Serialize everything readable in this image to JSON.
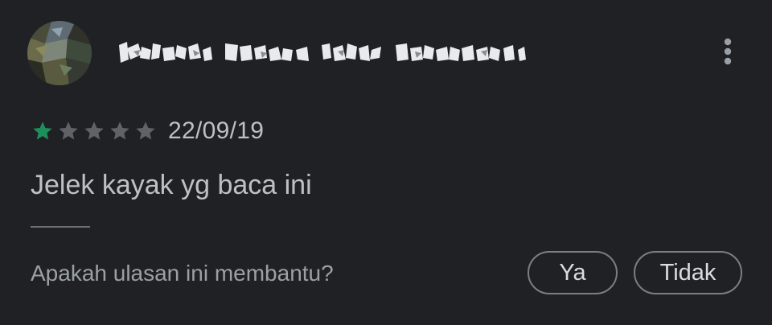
{
  "review": {
    "author": {
      "name": "Kristo Marta Nugroho Pratama",
      "name_obscured": true,
      "avatar_icon": "blurred-profile-photo"
    },
    "menu_icon": "more-vert-icon",
    "rating": {
      "value": 1,
      "max": 5,
      "filled_color": "#1e8e5c",
      "empty_color": "#5f6368"
    },
    "date": "22/09/19",
    "text": "Jelek kayak yg baca ini"
  },
  "helpful": {
    "question": "Apakah ulasan ini membantu?",
    "yes_label": "Ya",
    "no_label": "Tidak"
  },
  "colors": {
    "background": "#202124",
    "text": "#bdc1c6",
    "muted_text": "#9aa0a6",
    "chip_border": "#7b7f84",
    "accent_star": "#1e8e5c"
  }
}
